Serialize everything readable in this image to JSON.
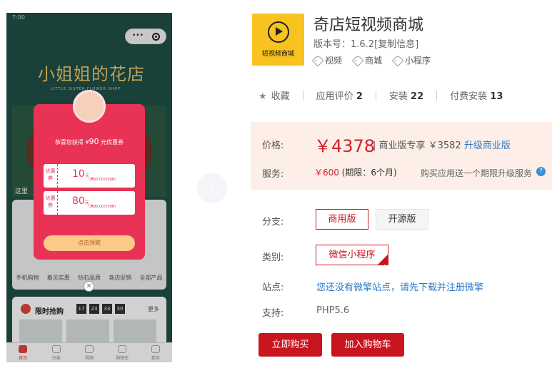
{
  "phone": {
    "status_time": "7:00",
    "status_right": "",
    "hero_title": "小姐姐的花店",
    "hero_sub": "LITTLE SISTER FLOWER SHOP",
    "banner_label": "这里",
    "grid_row1": [
      "",
      "",
      "",
      ""
    ],
    "grid_row2": [
      "手机购物",
      "着见实惠",
      "钻石品质",
      "身边促销",
      "全部产品"
    ],
    "sale_title": "限时抢购",
    "timer": [
      "17",
      "23",
      "33",
      "30"
    ],
    "more": "更多",
    "tabs": [
      "首页",
      "分类",
      "视频",
      "购物车",
      "我的"
    ],
    "coupon": {
      "headline_prefix": "恭喜您获得 ¥",
      "headline_amount": "90",
      "headline_suffix": " 元优惠券",
      "ticket_tag": "优惠券",
      "tickets": [
        {
          "amount": "10",
          "unit": "元",
          "cond": "（满50.00元可用）"
        },
        {
          "amount": "80",
          "unit": "元",
          "cond": "（满95.00元可用）"
        }
      ],
      "claim": "点击领取",
      "close": "×"
    },
    "next_arrow": "›"
  },
  "product": {
    "logo_text": "短视频商城",
    "title": "奇店短视频商城",
    "version": "版本号：1.6.2[复制信息]",
    "tags": [
      "视频",
      "商城",
      "小程序"
    ]
  },
  "stats": {
    "collect": "收藏",
    "rating_label": "应用评价",
    "rating_value": "2",
    "install_label": "安装",
    "install_value": "22",
    "paid_label": "付费安装",
    "paid_value": "13"
  },
  "pricing": {
    "price_label": "价格:",
    "price": "￥4378",
    "pro_text": "| 商业版专享 ￥3582",
    "upgrade": "升级商业版",
    "service_label": "服务:",
    "service_price": "￥600",
    "service_period": " (期限：6个月)",
    "service_note": "购买应用送一个期限升级服务",
    "help": "?"
  },
  "options": {
    "branch_label": "分支:",
    "branch_commercial": "商用版",
    "branch_open": "开源版",
    "category_label": "类别:",
    "category_value": "微信小程序",
    "site_label": "站点:",
    "site_text": "您还没有微擎站点，请先下载并注册微擎",
    "support_label": "支持:",
    "support_value": "PHP5.6"
  },
  "actions": {
    "buy_now": "立即购买",
    "add_cart": "加入购物车"
  }
}
